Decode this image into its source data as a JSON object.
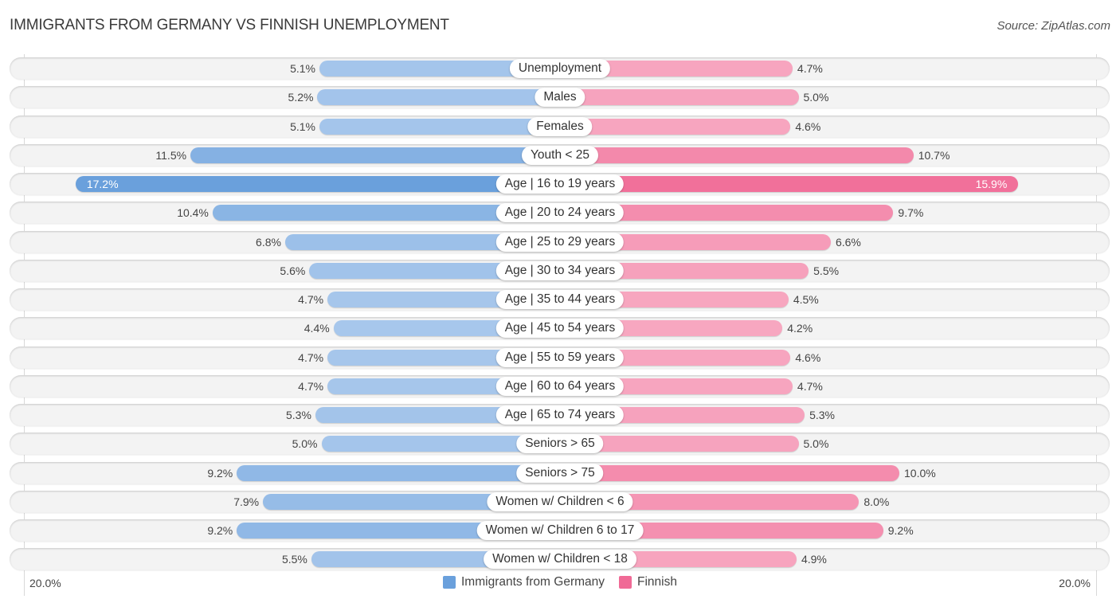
{
  "chart_data": {
    "type": "bar",
    "orientation": "horizontal-diverging",
    "title": "IMMIGRANTS FROM GERMANY VS FINNISH UNEMPLOYMENT",
    "source": "Source: ZipAtlas.com",
    "categories": [
      "Unemployment",
      "Males",
      "Females",
      "Youth < 25",
      "Age | 16 to 19 years",
      "Age | 20 to 24 years",
      "Age | 25 to 29 years",
      "Age | 30 to 34 years",
      "Age | 35 to 44 years",
      "Age | 45 to 54 years",
      "Age | 55 to 59 years",
      "Age | 60 to 64 years",
      "Age | 65 to 74 years",
      "Seniors > 65",
      "Seniors > 75",
      "Women w/ Children < 6",
      "Women w/ Children 6 to 17",
      "Women w/ Children < 18"
    ],
    "series": [
      {
        "name": "Immigrants from Germany",
        "side": "left",
        "color": "#6aa0dc",
        "values": [
          5.1,
          5.2,
          5.1,
          11.5,
          17.2,
          10.4,
          6.8,
          5.6,
          4.7,
          4.4,
          4.7,
          4.7,
          5.3,
          5.0,
          9.2,
          7.9,
          9.2,
          5.5
        ],
        "labels": [
          "5.1%",
          "5.2%",
          "5.1%",
          "11.5%",
          "17.2%",
          "10.4%",
          "6.8%",
          "5.6%",
          "4.7%",
          "4.4%",
          "4.7%",
          "4.7%",
          "5.3%",
          "5.0%",
          "9.2%",
          "7.9%",
          "9.2%",
          "5.5%"
        ]
      },
      {
        "name": "Finnish",
        "side": "right",
        "color": "#f06a96",
        "values": [
          4.7,
          5.0,
          4.6,
          10.7,
          15.9,
          9.7,
          6.6,
          5.5,
          4.5,
          4.2,
          4.6,
          4.7,
          5.3,
          5.0,
          10.0,
          8.0,
          9.2,
          4.9
        ],
        "labels": [
          "4.7%",
          "5.0%",
          "4.6%",
          "10.7%",
          "15.9%",
          "9.7%",
          "6.6%",
          "5.5%",
          "4.5%",
          "4.2%",
          "4.6%",
          "4.7%",
          "5.3%",
          "5.0%",
          "10.0%",
          "8.0%",
          "9.2%",
          "4.9%"
        ]
      }
    ],
    "xlim": [
      0,
      20
    ],
    "axis_labels": {
      "left": "20.0%",
      "right": "20.0%"
    },
    "legend": {
      "position": "bottom-center"
    },
    "grid": false
  }
}
